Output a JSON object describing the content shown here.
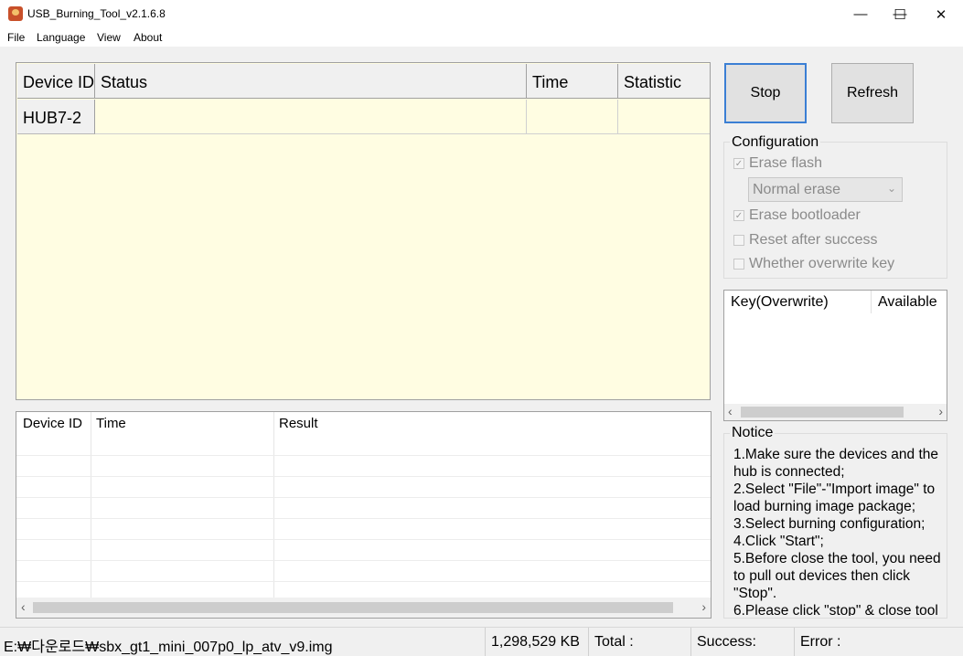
{
  "window": {
    "title": "USB_Burning_Tool_v2.1.6.8",
    "minimize_glyph": "—",
    "maximize_glyph": "☐",
    "close_glyph": "✕"
  },
  "menu": [
    "File",
    "Language",
    "View",
    "About"
  ],
  "device_grid": {
    "headers": [
      "Device ID",
      "Status",
      "Time",
      "Statistic"
    ],
    "rows": [
      {
        "device_id": "HUB7-2",
        "status": "",
        "time": "",
        "statistic": ""
      }
    ]
  },
  "log_table": {
    "headers": [
      "Device ID",
      "Time",
      "Result"
    ],
    "rows": []
  },
  "buttons": {
    "stop": "Stop",
    "refresh": "Refresh"
  },
  "configuration": {
    "title": "Configuration",
    "erase_flash": {
      "label": "Erase flash",
      "checked": true,
      "enabled": false
    },
    "erase_mode": {
      "value": "Normal erase",
      "enabled": false
    },
    "erase_bootloader": {
      "label": "Erase bootloader",
      "checked": true,
      "enabled": false
    },
    "reset_after_success": {
      "label": "Reset after success",
      "checked": false,
      "enabled": false
    },
    "overwrite_key": {
      "label": "Whether overwrite key",
      "checked": false,
      "enabled": false
    }
  },
  "key_table": {
    "headers": [
      "Key(Overwrite)",
      "Available"
    ]
  },
  "notice": {
    "title": "Notice",
    "lines": [
      "1.Make sure the devices and the hub is connected;",
      "2.Select \"File\"-\"Import image\" to load burning image package;",
      "3.Select burning configuration;",
      "4.Click \"Start\";",
      "5.Before close the tool, you need to pull out devices then click \"Stop\".",
      "6.Please click \"stop\" & close tool"
    ]
  },
  "status_bar": {
    "image_path": "E:₩다운로드₩sbx_gt1_mini_007p0_lp_atv_v9.img",
    "size": "1,298,529 KB",
    "total": "Total :",
    "success": "Success:",
    "error": "Error :"
  }
}
